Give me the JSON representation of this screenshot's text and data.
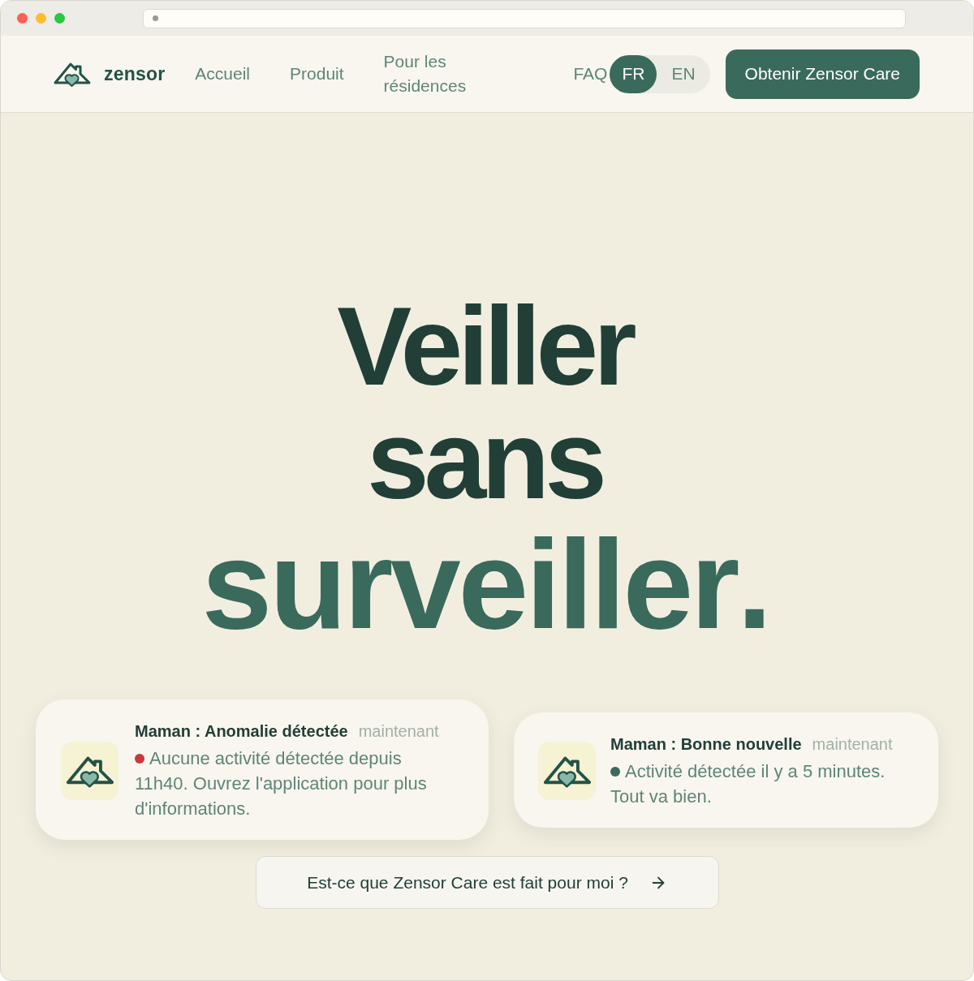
{
  "nav": {
    "brand": "zensor",
    "links": [
      {
        "label": "Accueil"
      },
      {
        "label": "Produit"
      },
      {
        "label": "Pour les résidences"
      }
    ],
    "faq": "FAQ",
    "languages": [
      {
        "label": "FR",
        "selected": true
      },
      {
        "label": "EN",
        "selected": false
      }
    ],
    "cta": "Obtenir Zensor Care"
  },
  "hero": {
    "headline": [
      {
        "text": "Veiller",
        "kind": "dark"
      },
      {
        "text": "sans",
        "kind": "dark"
      },
      {
        "text": "surveiller.",
        "kind": "accent"
      }
    ]
  },
  "notifications": [
    {
      "title": "Maman : Anomalie détectée",
      "time": "maintenant",
      "message": "Aucune activité détectée depuis 11h40. Ouvrez l'application pour plus d'informations.",
      "color": "#c8393a"
    },
    {
      "title": "Maman : Bonne nouvelle",
      "time": "maintenant",
      "message": "Activité détectée il y a 5 minutes. Tout va bien.",
      "color": "#3a6a5c"
    }
  ],
  "quiz_button": "Est-ce que Zensor Care est fait pour moi ?"
}
